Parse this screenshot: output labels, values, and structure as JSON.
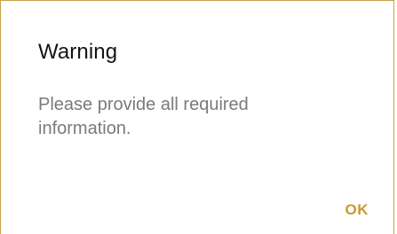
{
  "dialog": {
    "title": "Warning",
    "message": "Please provide all required information.",
    "ok_label": "OK"
  },
  "colors": {
    "accent": "#c79a2e",
    "border": "#c8a24a",
    "title": "#141414",
    "message": "#7a7a7a"
  }
}
